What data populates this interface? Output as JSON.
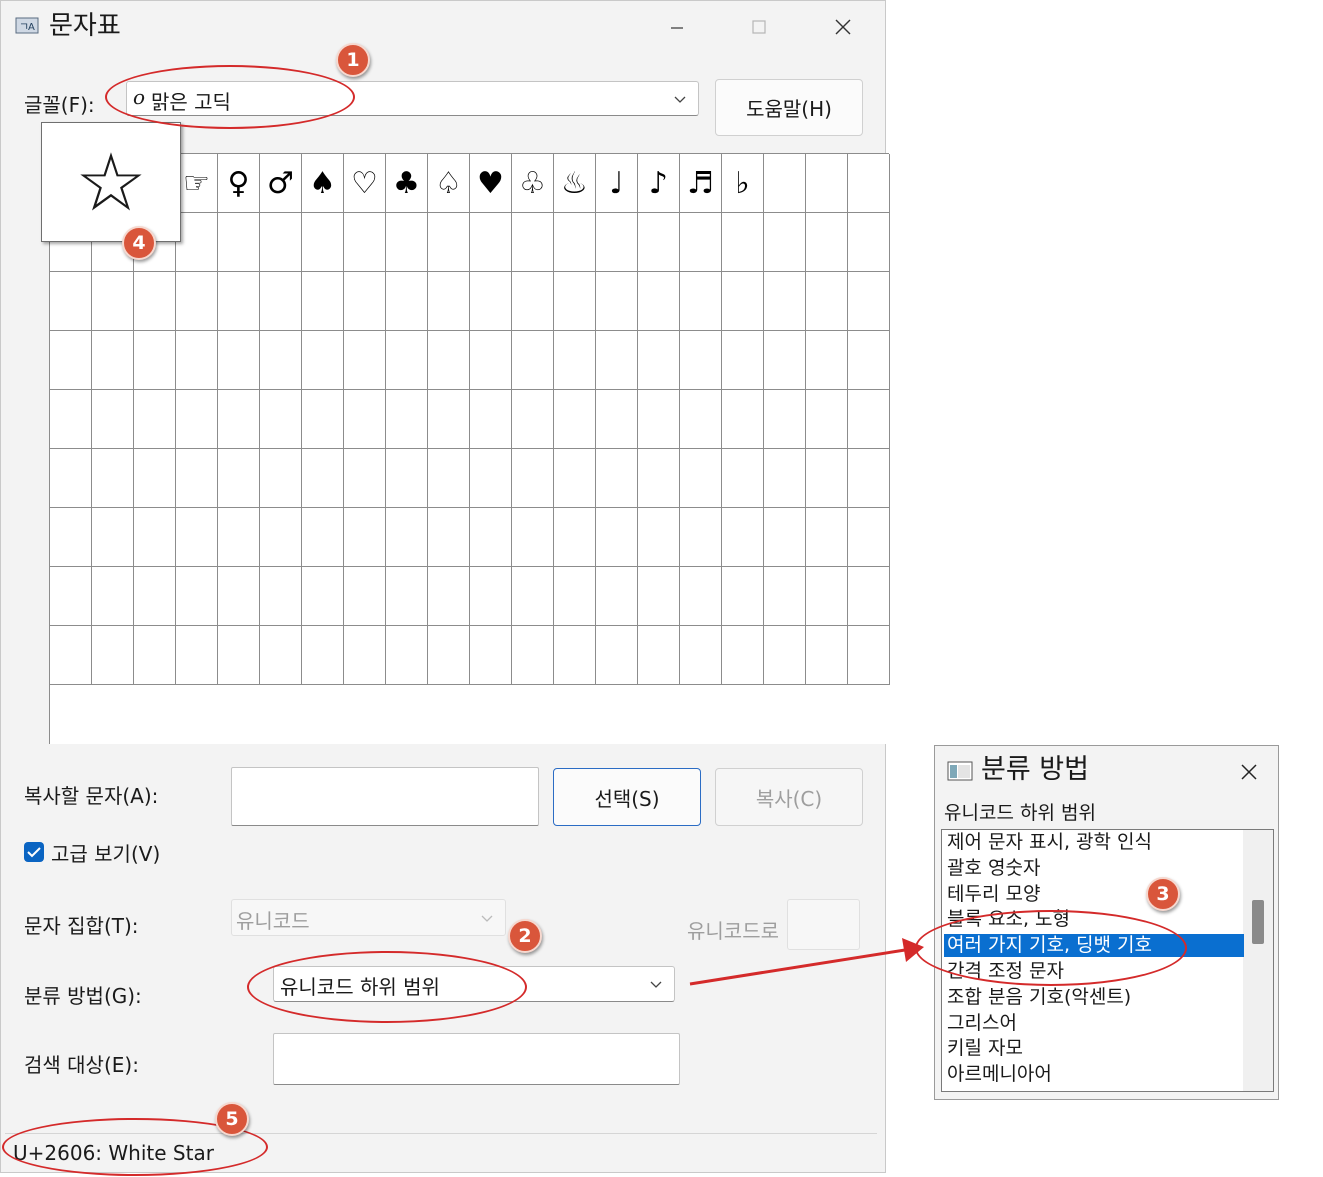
{
  "window": {
    "title": "문자표",
    "font_label": "글꼴(F):",
    "font_value": "맑은 고딕",
    "font_icon_glyph": "o",
    "help_button": "도움말(H)",
    "enlarged_char": "☆",
    "grid_chars": [
      "☆",
      "☎",
      "☜",
      "☞",
      "♀",
      "♂",
      "♠",
      "♡",
      "♣",
      "♤",
      "♥",
      "♧",
      "♨",
      "♩",
      "♪",
      "♬",
      "♭",
      ""
    ],
    "copy_label": "복사할 문자(A):",
    "copy_value": "",
    "select_button": "선택(S)",
    "copy_button": "복사(C)",
    "advanced_view_label": "고급 보기(V)",
    "advanced_view_checked": true,
    "charset_label": "문자 집합(T):",
    "charset_value": "유니코드",
    "goto_unicode_label": "유니코드로",
    "goto_unicode_value": "",
    "groupby_label": "분류 방법(G):",
    "groupby_value": "유니코드 하위 범위",
    "search_label": "검색 대상(E):",
    "search_value": "",
    "status": "U+2606: White Star"
  },
  "popup": {
    "title": "분류 방법",
    "subtitle": "유니코드 하위 범위",
    "items": [
      "제어 문자 표시, 광학 인식",
      "괄호 영숫자",
      "테두리 모양",
      "블록 요소, 도형",
      "여러 가지 기호, 딩뱃 기호",
      "간격 조정 문자",
      "조합 분음 기호(악센트)",
      "그리스어",
      "키릴 자모",
      "아르메니아어"
    ],
    "selected_index": 4
  },
  "annotations": {
    "badges": [
      "1",
      "2",
      "3",
      "4",
      "5"
    ],
    "accent_color": "#d42a2a",
    "badge_color": "#d9563b",
    "selection_color": "#0a6fd0"
  }
}
